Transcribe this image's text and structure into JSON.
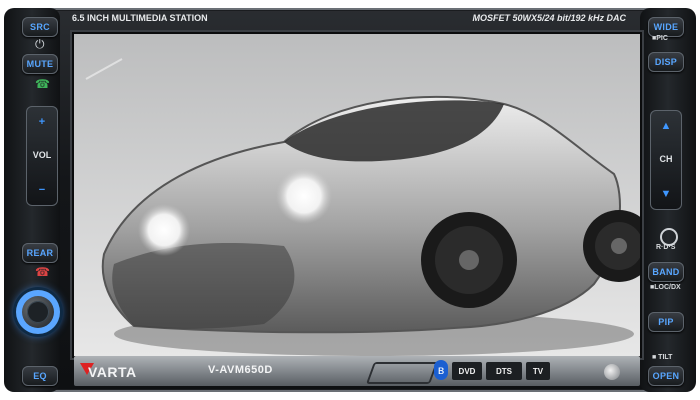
{
  "top_bar": {
    "title": "6.5 INCH MULTIMEDIA STATION",
    "spec": "MOSFET 50WX5/24 bit/192 kHz DAC"
  },
  "left_controls": {
    "src": "SRC",
    "mute": "MUTE",
    "vol_label": "VOL",
    "vol_plus": "+",
    "vol_minus": "−",
    "rear": "REAR",
    "eq": "EQ"
  },
  "right_controls": {
    "wide": "WIDE",
    "pic": "■PIC",
    "disp": "DISP",
    "ch_label": "CH",
    "ch_up": "▲",
    "ch_down": "▼",
    "rds": "R·D·S",
    "band": "BAND",
    "loc_dx": "■LOC/DX",
    "pip": "PIP",
    "tilt": "■ TILT",
    "open": "OPEN"
  },
  "bottom_bar": {
    "brand": "VARTA",
    "model": "V-AVM650D",
    "logos": [
      "DVD",
      "DTS",
      "TV"
    ]
  },
  "icons": {
    "power": "power-icon",
    "phone": "phone-icon",
    "bluetooth": "bluetooth-icon",
    "rds_ring": "rds-ring-icon"
  },
  "colors": {
    "accent": "#58a6ff",
    "screen_bg": "#d9dadb"
  }
}
